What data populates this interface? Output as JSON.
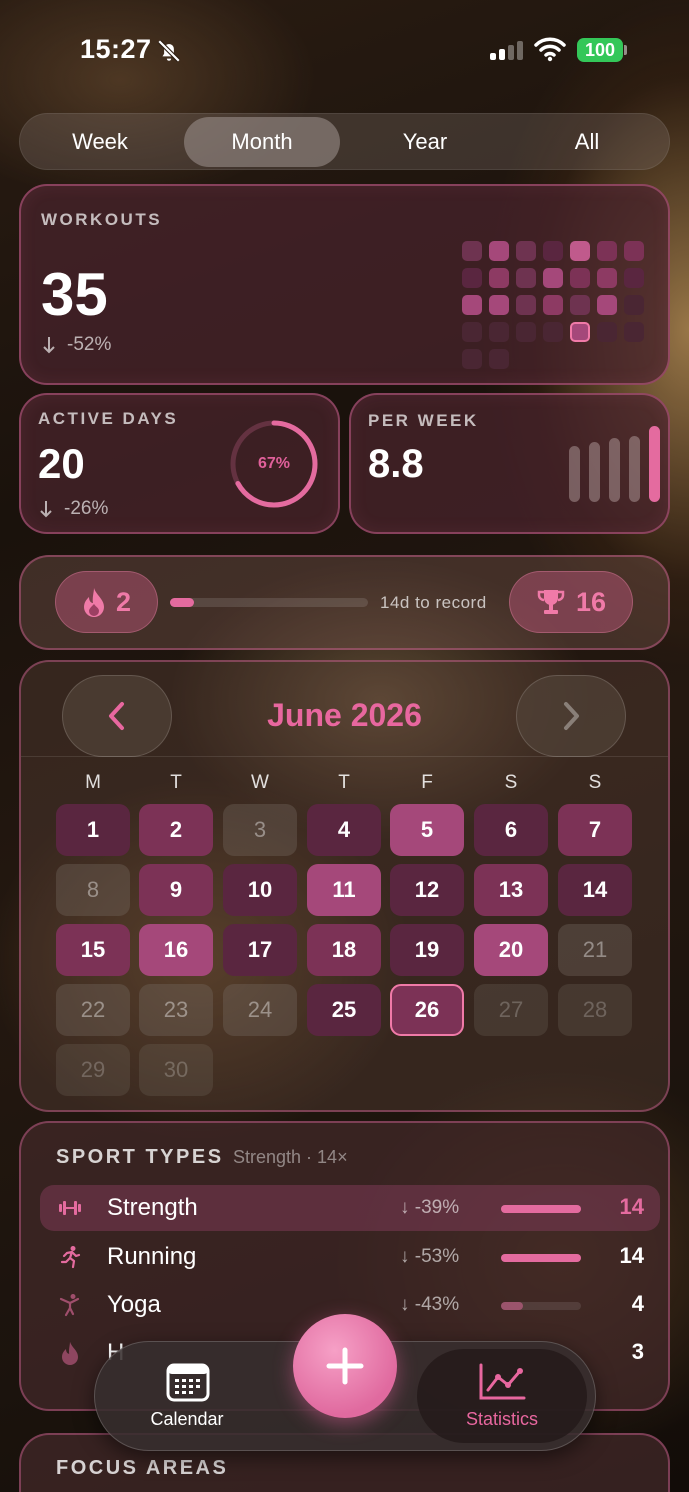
{
  "status_bar": {
    "time": "15:27",
    "battery": "100"
  },
  "period_tabs": [
    "Week",
    "Month",
    "Year",
    "All"
  ],
  "workouts": {
    "label": "WORKOUTS",
    "value": "35",
    "delta": "-52%"
  },
  "active_days": {
    "label": "ACTIVE DAYS",
    "value": "20",
    "delta": "-26%",
    "ring_text": "67%",
    "ring_fraction": 0.67
  },
  "per_week": {
    "label": "PER WEEK",
    "value": "8.8"
  },
  "streak": {
    "current": "2",
    "record_text": "14d to record",
    "record": "16",
    "progress_fraction": 0.12
  },
  "calendar": {
    "title": "June 2026",
    "weekdays": [
      "M",
      "T",
      "W",
      "T",
      "F",
      "S",
      "S"
    ],
    "days": [
      "1",
      "2",
      "3",
      "4",
      "5",
      "6",
      "7",
      "8",
      "9",
      "10",
      "11",
      "12",
      "13",
      "14",
      "15",
      "16",
      "17",
      "18",
      "19",
      "20",
      "21",
      "22",
      "23",
      "24",
      "25",
      "26",
      "27",
      "28",
      "29",
      "30"
    ]
  },
  "sport_types": {
    "label": "SPORT TYPES",
    "subtitle": "Strength · 14×",
    "rows": [
      {
        "name": "Strength",
        "delta": "-39%",
        "count": "14",
        "fraction": 1.0
      },
      {
        "name": "Running",
        "delta": "-53%",
        "count": "14",
        "fraction": 1.0
      },
      {
        "name": "Yoga",
        "delta": "-43%",
        "count": "4",
        "fraction": 0.28
      },
      {
        "name": "H",
        "delta": "",
        "count": "3",
        "fraction": 0.2
      }
    ]
  },
  "tabbar": {
    "calendar_label": "Calendar",
    "statistics_label": "Statistics"
  },
  "focus_areas": {
    "label": "FOCUS AREAS"
  },
  "colors": {
    "accent": "#e8679f",
    "battery": "#34c759"
  }
}
